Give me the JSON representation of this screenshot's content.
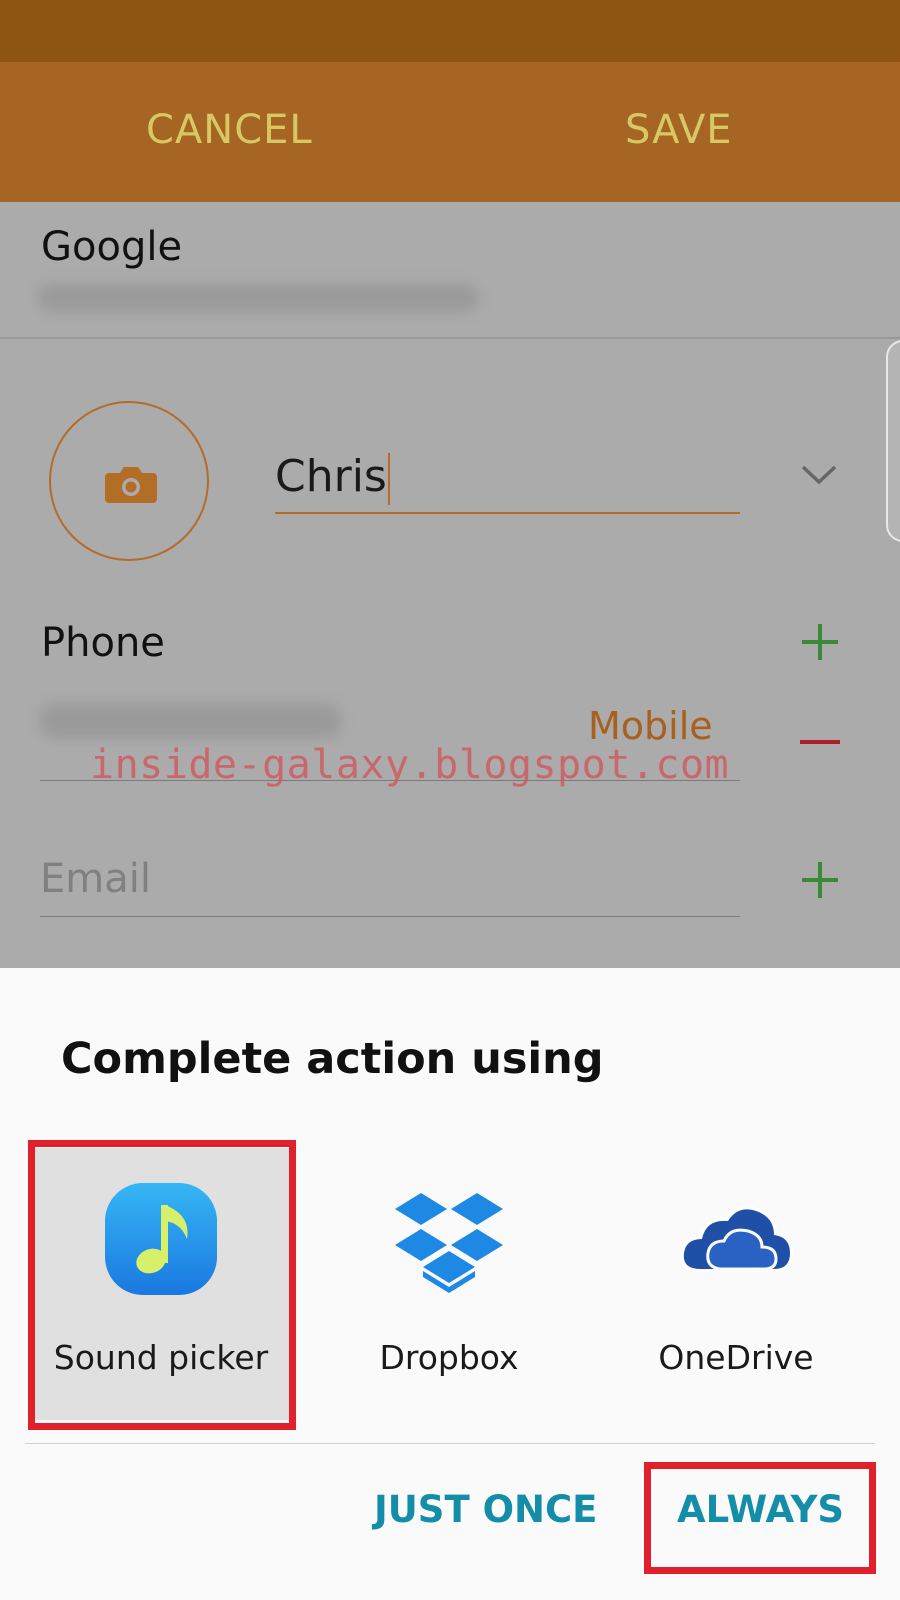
{
  "action_bar": {
    "cancel_label": "CANCEL",
    "save_label": "SAVE"
  },
  "form": {
    "account_label": "Google",
    "name_value": "Chris",
    "phone_section_label": "Phone",
    "phone_type": "Mobile",
    "email_placeholder": "Email"
  },
  "watermark": "inside-galaxy.blogspot.com",
  "sheet": {
    "title": "Complete action using",
    "apps": [
      {
        "label": "Sound picker",
        "icon": "sound-picker-icon",
        "selected": true
      },
      {
        "label": "Dropbox",
        "icon": "dropbox-icon",
        "selected": false
      },
      {
        "label": "OneDrive",
        "icon": "onedrive-icon",
        "selected": false
      }
    ],
    "just_once_label": "JUST ONCE",
    "always_label": "ALWAYS"
  },
  "colors": {
    "status_bar": "#8f5314",
    "action_bar": "#a66522",
    "action_text": "#d6c867",
    "accent": "#b26d27",
    "plus_green": "#3a8a3a",
    "minus_red": "#b01e2c",
    "button_teal": "#148ea8",
    "highlight_red": "#e0202a"
  }
}
